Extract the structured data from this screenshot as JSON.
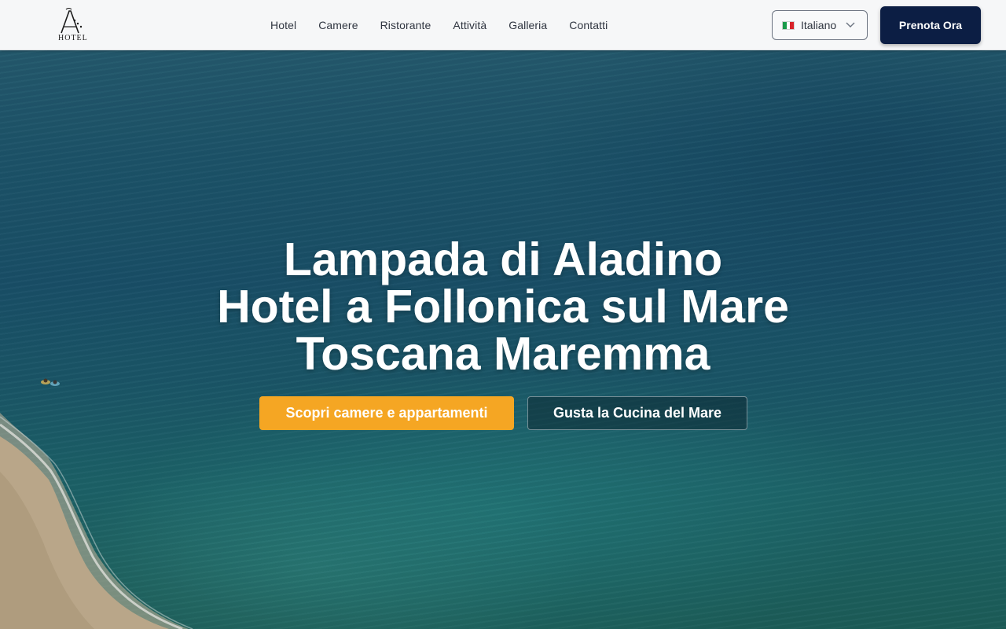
{
  "header": {
    "logo_text": "HOTEL",
    "nav": [
      {
        "label": "Hotel"
      },
      {
        "label": "Camere"
      },
      {
        "label": "Ristorante"
      },
      {
        "label": "Attività"
      },
      {
        "label": "Galleria"
      },
      {
        "label": "Contatti"
      }
    ],
    "language": {
      "label": "Italiano",
      "flag": "italy-flag-icon"
    },
    "book_label": "Prenota Ora"
  },
  "hero": {
    "title_lines": [
      "Lampada di Aladino",
      "Hotel a Follonica sul Mare",
      "Toscana Maremma"
    ],
    "cta_primary": "Scopri camere e appartamenti",
    "cta_secondary": "Gusta la Cucina del Mare"
  },
  "colors": {
    "header_bg": "#f6f7f8",
    "book_button": "#0c1e44",
    "cta_primary": "#f5a623",
    "nav_text": "#2f3540"
  }
}
